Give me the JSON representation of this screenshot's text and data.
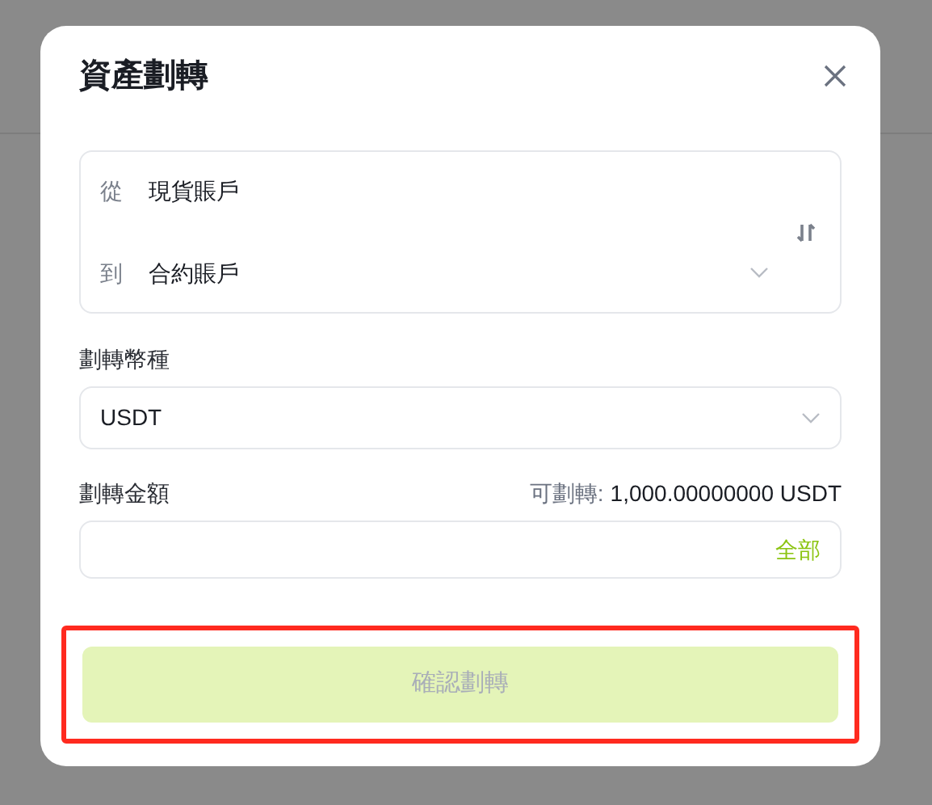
{
  "dialog": {
    "title": "資產劃轉",
    "accounts": [
      {
        "label": "從",
        "value": "現貨賬戶",
        "dropdown": false
      },
      {
        "label": "到",
        "value": "合約賬戶",
        "dropdown": true
      }
    ],
    "currency": {
      "label": "劃轉幣種",
      "value": "USDT"
    },
    "amount": {
      "label": "劃轉金額",
      "available_label": "可劃轉:",
      "available_value": "1,000.00000000 USDT",
      "max_link": "全部"
    },
    "confirm": {
      "label": "確認劃轉",
      "disabled": true,
      "highlighted": true
    }
  }
}
